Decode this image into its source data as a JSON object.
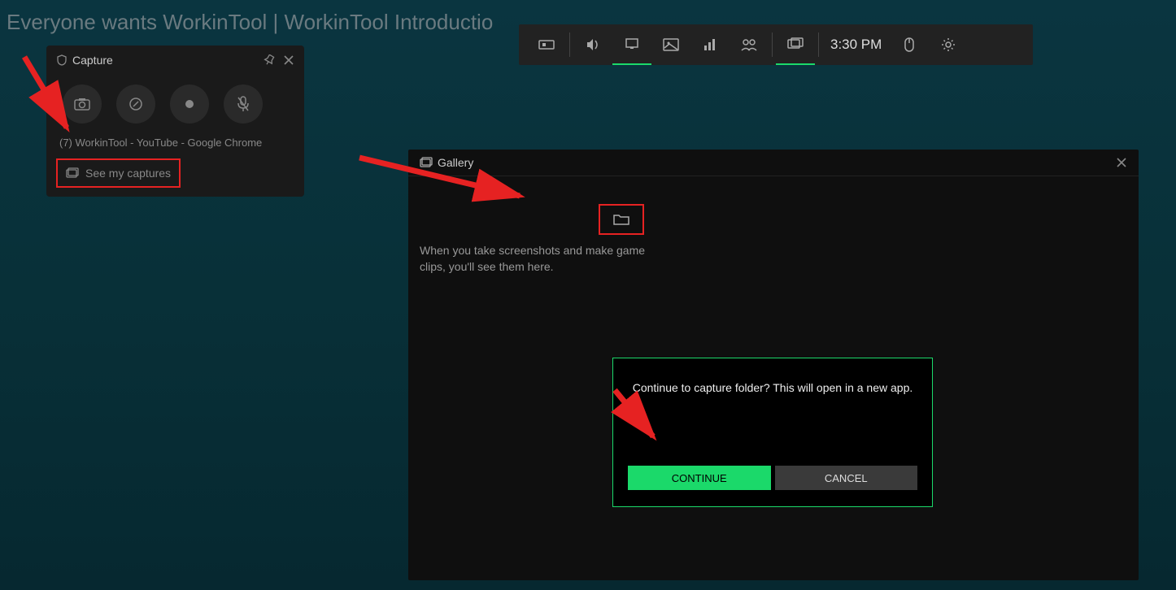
{
  "background": {
    "window_title": "Everyone wants WorkinTool | WorkinTool Introductio"
  },
  "gamebar": {
    "time": "3:30 PM",
    "icons": [
      "xbox-icon",
      "speaker-icon",
      "monitor-icon",
      "image-icon",
      "chart-icon",
      "people-icon",
      "widgets-icon",
      "mouse-icon",
      "gear-icon"
    ]
  },
  "capture": {
    "title": "Capture",
    "source": "(7) WorkinTool - YouTube - Google Chrome",
    "see_captures_label": "See my captures"
  },
  "gallery": {
    "title": "Gallery",
    "empty_text": "When you take screenshots and make game clips, you'll see them here."
  },
  "dialog": {
    "message": "Continue to capture folder? This will open in a new app.",
    "continue_label": "CONTINUE",
    "cancel_label": "CANCEL"
  }
}
